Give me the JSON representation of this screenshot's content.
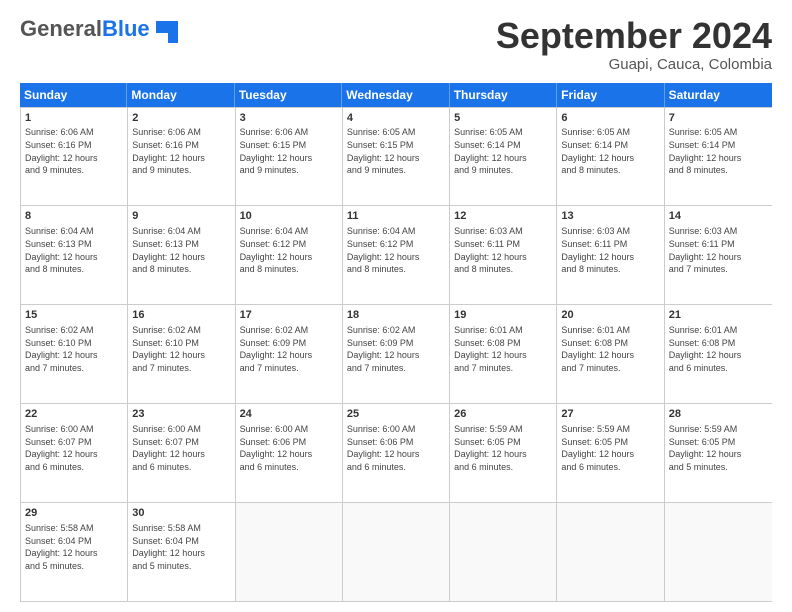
{
  "header": {
    "logo_general": "General",
    "logo_blue": "Blue",
    "month_title": "September 2024",
    "subtitle": "Guapi, Cauca, Colombia"
  },
  "calendar": {
    "days_of_week": [
      "Sunday",
      "Monday",
      "Tuesday",
      "Wednesday",
      "Thursday",
      "Friday",
      "Saturday"
    ],
    "rows": [
      [
        {
          "day": "",
          "empty": true
        },
        {
          "day": "",
          "empty": true
        },
        {
          "day": "",
          "empty": true
        },
        {
          "day": "",
          "empty": true
        },
        {
          "day": "",
          "empty": true
        },
        {
          "day": "",
          "empty": true
        },
        {
          "day": "",
          "empty": true
        }
      ]
    ],
    "weeks": [
      {
        "cells": [
          {
            "day": "1",
            "lines": [
              "Sunrise: 6:06 AM",
              "Sunset: 6:16 PM",
              "Daylight: 12 hours",
              "and 9 minutes."
            ]
          },
          {
            "day": "2",
            "lines": [
              "Sunrise: 6:06 AM",
              "Sunset: 6:16 PM",
              "Daylight: 12 hours",
              "and 9 minutes."
            ]
          },
          {
            "day": "3",
            "lines": [
              "Sunrise: 6:06 AM",
              "Sunset: 6:15 PM",
              "Daylight: 12 hours",
              "and 9 minutes."
            ]
          },
          {
            "day": "4",
            "lines": [
              "Sunrise: 6:05 AM",
              "Sunset: 6:15 PM",
              "Daylight: 12 hours",
              "and 9 minutes."
            ]
          },
          {
            "day": "5",
            "lines": [
              "Sunrise: 6:05 AM",
              "Sunset: 6:14 PM",
              "Daylight: 12 hours",
              "and 9 minutes."
            ]
          },
          {
            "day": "6",
            "lines": [
              "Sunrise: 6:05 AM",
              "Sunset: 6:14 PM",
              "Daylight: 12 hours",
              "and 8 minutes."
            ]
          },
          {
            "day": "7",
            "lines": [
              "Sunrise: 6:05 AM",
              "Sunset: 6:14 PM",
              "Daylight: 12 hours",
              "and 8 minutes."
            ]
          }
        ]
      },
      {
        "cells": [
          {
            "day": "8",
            "lines": [
              "Sunrise: 6:04 AM",
              "Sunset: 6:13 PM",
              "Daylight: 12 hours",
              "and 8 minutes."
            ]
          },
          {
            "day": "9",
            "lines": [
              "Sunrise: 6:04 AM",
              "Sunset: 6:13 PM",
              "Daylight: 12 hours",
              "and 8 minutes."
            ]
          },
          {
            "day": "10",
            "lines": [
              "Sunrise: 6:04 AM",
              "Sunset: 6:12 PM",
              "Daylight: 12 hours",
              "and 8 minutes."
            ]
          },
          {
            "day": "11",
            "lines": [
              "Sunrise: 6:04 AM",
              "Sunset: 6:12 PM",
              "Daylight: 12 hours",
              "and 8 minutes."
            ]
          },
          {
            "day": "12",
            "lines": [
              "Sunrise: 6:03 AM",
              "Sunset: 6:11 PM",
              "Daylight: 12 hours",
              "and 8 minutes."
            ]
          },
          {
            "day": "13",
            "lines": [
              "Sunrise: 6:03 AM",
              "Sunset: 6:11 PM",
              "Daylight: 12 hours",
              "and 8 minutes."
            ]
          },
          {
            "day": "14",
            "lines": [
              "Sunrise: 6:03 AM",
              "Sunset: 6:11 PM",
              "Daylight: 12 hours",
              "and 7 minutes."
            ]
          }
        ]
      },
      {
        "cells": [
          {
            "day": "15",
            "lines": [
              "Sunrise: 6:02 AM",
              "Sunset: 6:10 PM",
              "Daylight: 12 hours",
              "and 7 minutes."
            ]
          },
          {
            "day": "16",
            "lines": [
              "Sunrise: 6:02 AM",
              "Sunset: 6:10 PM",
              "Daylight: 12 hours",
              "and 7 minutes."
            ]
          },
          {
            "day": "17",
            "lines": [
              "Sunrise: 6:02 AM",
              "Sunset: 6:09 PM",
              "Daylight: 12 hours",
              "and 7 minutes."
            ]
          },
          {
            "day": "18",
            "lines": [
              "Sunrise: 6:02 AM",
              "Sunset: 6:09 PM",
              "Daylight: 12 hours",
              "and 7 minutes."
            ]
          },
          {
            "day": "19",
            "lines": [
              "Sunrise: 6:01 AM",
              "Sunset: 6:08 PM",
              "Daylight: 12 hours",
              "and 7 minutes."
            ]
          },
          {
            "day": "20",
            "lines": [
              "Sunrise: 6:01 AM",
              "Sunset: 6:08 PM",
              "Daylight: 12 hours",
              "and 7 minutes."
            ]
          },
          {
            "day": "21",
            "lines": [
              "Sunrise: 6:01 AM",
              "Sunset: 6:08 PM",
              "Daylight: 12 hours",
              "and 6 minutes."
            ]
          }
        ]
      },
      {
        "cells": [
          {
            "day": "22",
            "lines": [
              "Sunrise: 6:00 AM",
              "Sunset: 6:07 PM",
              "Daylight: 12 hours",
              "and 6 minutes."
            ]
          },
          {
            "day": "23",
            "lines": [
              "Sunrise: 6:00 AM",
              "Sunset: 6:07 PM",
              "Daylight: 12 hours",
              "and 6 minutes."
            ]
          },
          {
            "day": "24",
            "lines": [
              "Sunrise: 6:00 AM",
              "Sunset: 6:06 PM",
              "Daylight: 12 hours",
              "and 6 minutes."
            ]
          },
          {
            "day": "25",
            "lines": [
              "Sunrise: 6:00 AM",
              "Sunset: 6:06 PM",
              "Daylight: 12 hours",
              "and 6 minutes."
            ]
          },
          {
            "day": "26",
            "lines": [
              "Sunrise: 5:59 AM",
              "Sunset: 6:05 PM",
              "Daylight: 12 hours",
              "and 6 minutes."
            ]
          },
          {
            "day": "27",
            "lines": [
              "Sunrise: 5:59 AM",
              "Sunset: 6:05 PM",
              "Daylight: 12 hours",
              "and 6 minutes."
            ]
          },
          {
            "day": "28",
            "lines": [
              "Sunrise: 5:59 AM",
              "Sunset: 6:05 PM",
              "Daylight: 12 hours",
              "and 5 minutes."
            ]
          }
        ]
      },
      {
        "cells": [
          {
            "day": "29",
            "lines": [
              "Sunrise: 5:58 AM",
              "Sunset: 6:04 PM",
              "Daylight: 12 hours",
              "and 5 minutes."
            ]
          },
          {
            "day": "30",
            "lines": [
              "Sunrise: 5:58 AM",
              "Sunset: 6:04 PM",
              "Daylight: 12 hours",
              "and 5 minutes."
            ]
          },
          {
            "day": "",
            "empty": true,
            "lines": []
          },
          {
            "day": "",
            "empty": true,
            "lines": []
          },
          {
            "day": "",
            "empty": true,
            "lines": []
          },
          {
            "day": "",
            "empty": true,
            "lines": []
          },
          {
            "day": "",
            "empty": true,
            "lines": []
          }
        ]
      }
    ]
  }
}
